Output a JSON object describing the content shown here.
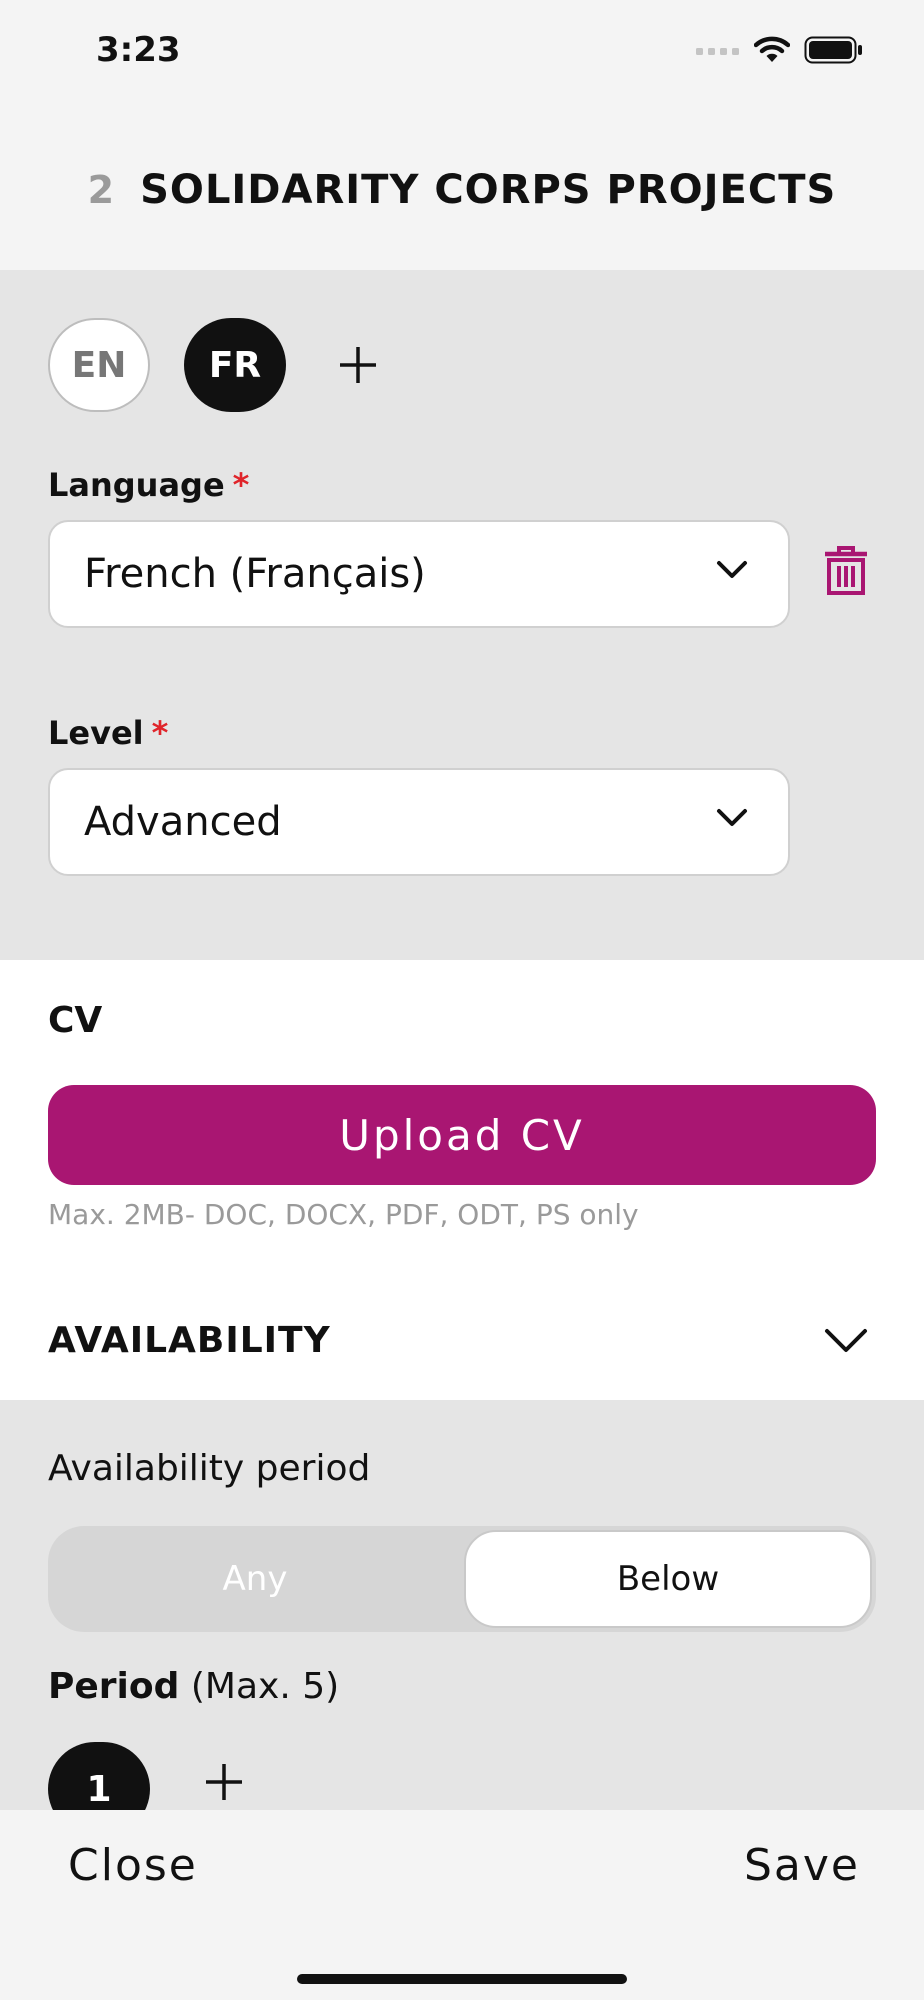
{
  "status_bar": {
    "time": "3:23"
  },
  "header": {
    "count": "2",
    "title": "SOLIDARITY CORPS PROJECTS"
  },
  "languages": {
    "tabs": [
      {
        "label": "EN",
        "active": false
      },
      {
        "label": "FR",
        "active": true
      }
    ],
    "language_label": "Language",
    "language_value": "French (Français)",
    "level_label": "Level",
    "level_value": "Advanced",
    "required_mark": "*"
  },
  "cv": {
    "label": "CV",
    "upload_label": "Upload CV",
    "hint": "Max. 2MB- DOC, DOCX, PDF, ODT, PS only"
  },
  "availability": {
    "title": "AVAILABILITY",
    "period_label": "Availability period",
    "options": [
      "Any",
      "Below"
    ],
    "selected": "Below",
    "period_title": "Period",
    "period_max": "(Max. 5)",
    "periods": [
      "1"
    ]
  },
  "footer": {
    "close_label": "Close",
    "save_label": "Save"
  },
  "colors": {
    "accent": "#a91672",
    "required": "#e0242a",
    "dark": "#111111"
  }
}
